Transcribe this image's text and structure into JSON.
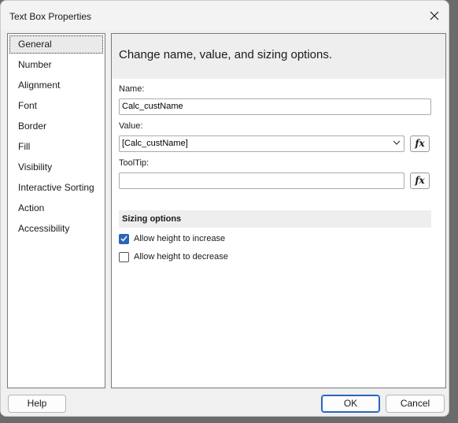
{
  "window": {
    "title": "Text Box Properties"
  },
  "nav": {
    "items": [
      {
        "label": "General",
        "selected": true
      },
      {
        "label": "Number"
      },
      {
        "label": "Alignment"
      },
      {
        "label": "Font"
      },
      {
        "label": "Border"
      },
      {
        "label": "Fill"
      },
      {
        "label": "Visibility"
      },
      {
        "label": "Interactive Sorting"
      },
      {
        "label": "Action"
      },
      {
        "label": "Accessibility"
      }
    ]
  },
  "content": {
    "header": "Change name, value, and sizing options.",
    "name_label": "Name:",
    "name_value": "Calc_custName",
    "value_label": "Value:",
    "value_value": "[Calc_custName]",
    "tooltip_label": "ToolTip:",
    "tooltip_value": "",
    "fx_label": "fx",
    "sizing_title": "Sizing options",
    "allow_increase_label": "Allow height to increase",
    "allow_increase_checked": true,
    "allow_decrease_label": "Allow height to decrease",
    "allow_decrease_checked": false
  },
  "buttons": {
    "help": "Help",
    "ok": "OK",
    "cancel": "Cancel"
  },
  "colors": {
    "accent": "#2a65b8",
    "panel_header": "#eeeeee",
    "dialog_bg": "#f0f0f0"
  }
}
